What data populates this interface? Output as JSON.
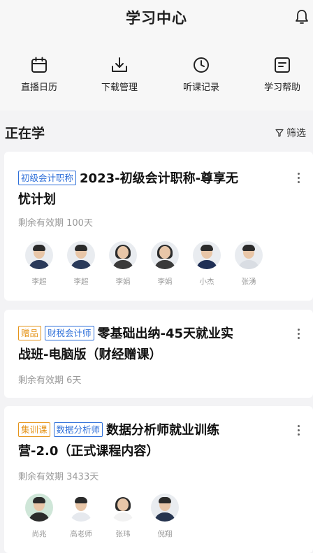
{
  "header": {
    "title": "学习中心",
    "bell_icon": "bell-icon"
  },
  "quicknav": [
    {
      "label": "直播日历",
      "icon": "calendar-icon"
    },
    {
      "label": "下载管理",
      "icon": "download-icon"
    },
    {
      "label": "听课记录",
      "icon": "clock-icon"
    },
    {
      "label": "学习帮助",
      "icon": "help-doc-icon"
    }
  ],
  "section": {
    "title": "正在学",
    "filter_label": "筛选"
  },
  "courses": [
    {
      "tags": [
        "初级会计职称"
      ],
      "title_line1": "2023-初级会计职称-尊享无",
      "title_line2": "忧计划",
      "validity": "剩余有效期 100天",
      "teachers": [
        "李超",
        "李超",
        "李娟",
        "李娟",
        "小杰",
        "张湧"
      ]
    },
    {
      "tags": [
        "赠品",
        "财税会计师"
      ],
      "title_line1": "零基础出纳-45天就业实",
      "title_line2": "战班-电脑版（财经赠课）",
      "validity": "剩余有效期 6天",
      "teachers": []
    },
    {
      "tags": [
        "集训课",
        "数据分析师"
      ],
      "title_line1": "数据分析师就业训练",
      "title_line2": "营-2.0（正式课程内容）",
      "validity": "剩余有效期 3433天",
      "teachers": [
        "尚兆",
        "高老师",
        "张玮",
        "倪翔"
      ]
    }
  ]
}
